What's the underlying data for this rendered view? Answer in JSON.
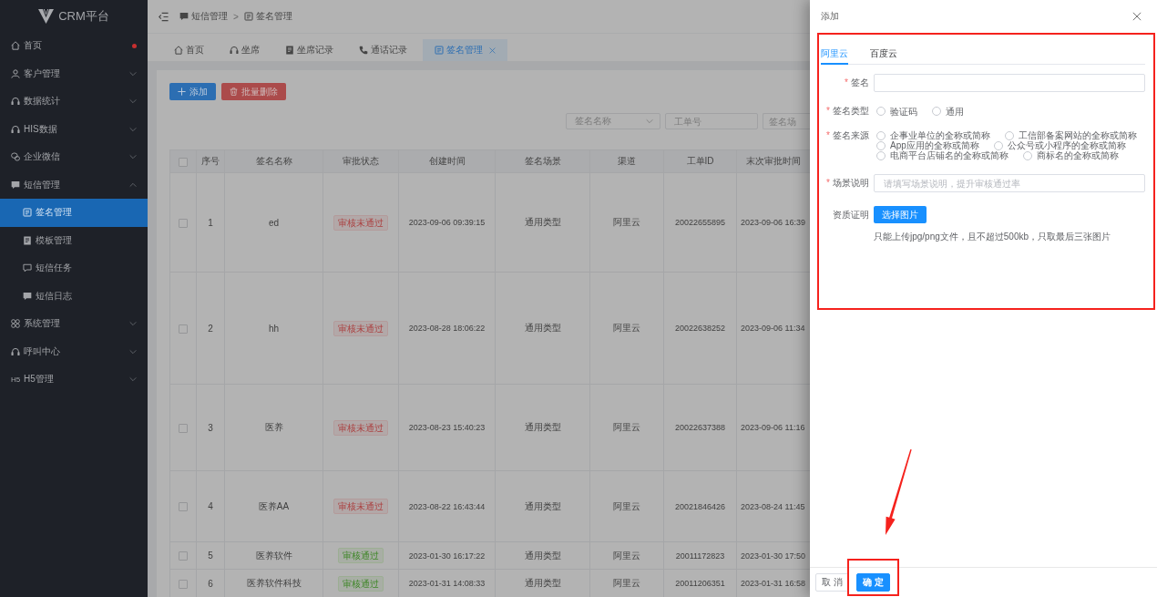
{
  "sidebar": {
    "logo": "CRM平台",
    "items": [
      {
        "kind": "link",
        "label": "首页",
        "selected": false,
        "dot": true
      },
      {
        "kind": "group",
        "label": "客户管理",
        "selected": false,
        "dot": false,
        "expanded": false
      },
      {
        "kind": "group",
        "label": "数据统计",
        "selected": false,
        "dot": false,
        "expanded": false
      },
      {
        "kind": "group",
        "label": "HIS数据",
        "selected": false,
        "dot": false,
        "expanded": false
      },
      {
        "kind": "group",
        "label": "企业微信",
        "selected": false,
        "dot": false,
        "expanded": false
      },
      {
        "kind": "group",
        "label": "短信管理",
        "selected": false,
        "dot": false,
        "expanded": true,
        "children": [
          {
            "label": "签名管理",
            "selected": true
          },
          {
            "label": "模板管理",
            "selected": false
          },
          {
            "label": "短信任务",
            "selected": false
          },
          {
            "label": "短信日志",
            "selected": false
          }
        ]
      },
      {
        "kind": "group",
        "label": "系统管理",
        "selected": false,
        "dot": false,
        "expanded": false
      },
      {
        "kind": "group",
        "label": "呼叫中心",
        "selected": false,
        "dot": false,
        "expanded": false
      },
      {
        "kind": "group",
        "label": "H5管理",
        "selected": false,
        "dot": false,
        "expanded": false,
        "glyph": "H5"
      }
    ]
  },
  "header": {
    "breadcrumb": [
      {
        "label": "短信管理"
      },
      {
        "label": "签名管理"
      }
    ],
    "separator": ">"
  },
  "tags": [
    {
      "label": "首页",
      "selected": false,
      "closable": false
    },
    {
      "label": "坐席",
      "selected": false,
      "closable": false
    },
    {
      "label": "坐席记录",
      "selected": false,
      "closable": false
    },
    {
      "label": "通话记录",
      "selected": false,
      "closable": false
    },
    {
      "label": "签名管理",
      "selected": true,
      "closable": true
    }
  ],
  "toolbar": [
    {
      "kind": "primary",
      "label": "添加"
    },
    {
      "kind": "danger",
      "label": "批量删除"
    }
  ],
  "filters": [
    {
      "kind": "select",
      "placeholder": "签名名称"
    },
    {
      "kind": "input",
      "placeholder": "工单号"
    },
    {
      "kind": "input",
      "placeholder": "签名场"
    }
  ],
  "table": {
    "select_all_checked": false,
    "columns": [
      "序号",
      "签名名称",
      "审批状态",
      "创建时间",
      "签名场景",
      "渠道",
      "工单ID",
      "末次审批时间"
    ],
    "rows": [
      {
        "checked": false,
        "no": "1",
        "name": "ed",
        "status": {
          "kind": "rejected",
          "label": "审核未通过"
        },
        "created": "2023-09-06 09:39:15",
        "scene": "通用类型",
        "channel": "阿里云",
        "ticket_id": "20022655895",
        "last_review": "2023-09-06 16:39"
      },
      {
        "checked": false,
        "no": "2",
        "name": "hh",
        "status": {
          "kind": "rejected",
          "label": "审核未通过"
        },
        "created": "2023-08-28 18:06:22",
        "scene": "通用类型",
        "channel": "阿里云",
        "ticket_id": "20022638252",
        "last_review": "2023-09-06 11:34"
      },
      {
        "checked": false,
        "no": "3",
        "name": "医养",
        "status": {
          "kind": "rejected",
          "label": "审核未通过"
        },
        "created": "2023-08-23 15:40:23",
        "scene": "通用类型",
        "channel": "阿里云",
        "ticket_id": "20022637388",
        "last_review": "2023-09-06 11:16"
      },
      {
        "checked": false,
        "no": "4",
        "name": "医养AA",
        "status": {
          "kind": "rejected",
          "label": "审核未通过"
        },
        "created": "2023-08-22 16:43:44",
        "scene": "通用类型",
        "channel": "阿里云",
        "ticket_id": "20021846426",
        "last_review": "2023-08-24 11:45"
      },
      {
        "checked": false,
        "no": "5",
        "name": "医养软件",
        "status": {
          "kind": "approved",
          "label": "审核通过"
        },
        "created": "2023-01-30 16:17:22",
        "scene": "通用类型",
        "channel": "阿里云",
        "ticket_id": "20011172823",
        "last_review": "2023-01-30 17:50"
      },
      {
        "checked": false,
        "no": "6",
        "name": "医养软件科技",
        "status": {
          "kind": "approved",
          "label": "审核通过"
        },
        "created": "2023-01-31 14:08:33",
        "scene": "通用类型",
        "channel": "阿里云",
        "ticket_id": "20011206351",
        "last_review": "2023-01-31 16:58"
      }
    ]
  },
  "drawer": {
    "title": "添加",
    "form_highlighted": true,
    "tabs": [
      {
        "label": "阿里云",
        "selected": true
      },
      {
        "label": "百度云",
        "selected": false
      }
    ],
    "form": [
      {
        "kind": "input",
        "required_mark": "*",
        "label": "签名"
      },
      {
        "kind": "radio",
        "required_mark": "*",
        "label": "签名类型",
        "options": [
          {
            "label": "验证码",
            "selected": false
          },
          {
            "label": "通用",
            "selected": false
          }
        ]
      },
      {
        "kind": "radio",
        "required_mark": "*",
        "label": "签名来源",
        "options": [
          {
            "label": "企事业单位的全称或简称",
            "selected": false
          },
          {
            "label": "工信部备案网站的全称或简称",
            "selected": false
          },
          {
            "label": "App应用的全称或简称",
            "selected": false
          },
          {
            "label": "公众号或小程序的全称或简称",
            "selected": false
          },
          {
            "label": "电商平台店铺名的全称或简称",
            "selected": false
          },
          {
            "label": "商标名的全称或简称",
            "selected": false
          }
        ]
      },
      {
        "kind": "input",
        "required_mark": "*",
        "label": "场景说明",
        "placeholder": "请填写场景说明，提升审核通过率"
      },
      {
        "kind": "upload",
        "label": "资质证明",
        "button": "选择图片",
        "hint": "只能上传jpg/png文件，且不超过500kb，只取最后三张图片"
      }
    ],
    "footer": [
      {
        "kind": "default",
        "label": "取 消",
        "highlighted": false,
        "arrow_pointing": false
      },
      {
        "kind": "primary",
        "label": "确 定",
        "highlighted": true,
        "arrow_pointing": true
      }
    ]
  }
}
